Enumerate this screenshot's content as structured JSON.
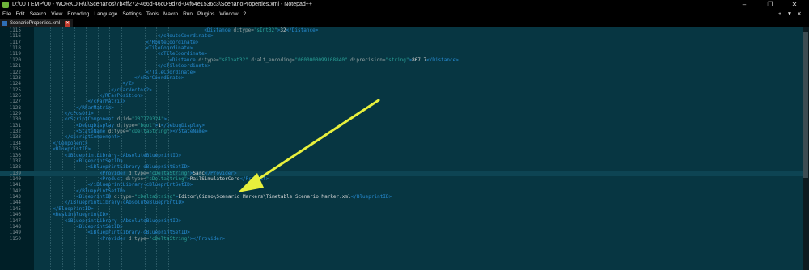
{
  "window": {
    "title": "D:\\00 TEMP\\00 - WORKDIR\\u\\Scenarios\\7b4ff272-466d-46c0-9d7d-04f64e1536c3\\ScenarioProperties.xml - Notepad++",
    "controls": [
      "–",
      "❐",
      "✕"
    ]
  },
  "menu": {
    "items": [
      "File",
      "Edit",
      "Search",
      "View",
      "Encoding",
      "Language",
      "Settings",
      "Tools",
      "Macro",
      "Run",
      "Plugins",
      "Window",
      "?"
    ],
    "right_tools": [
      "+",
      "▼",
      "✕"
    ]
  },
  "tab": {
    "label": "ScenarioProperties.xml",
    "close": "✕"
  },
  "editor": {
    "current_line": 1139,
    "lines": [
      {
        "n": "1115",
        "parts": [
          [
            "t",
            "<Distance"
          ],
          [
            "a",
            " d:type="
          ],
          [
            "s",
            "\"sInt32\""
          ],
          [
            "t",
            ">"
          ],
          [
            "x",
            "32"
          ],
          [
            "t",
            "</Distance>"
          ]
        ]
      },
      {
        "n": "1116",
        "parts": [
          [
            "t",
            "</cRouteCoordinate>"
          ]
        ]
      },
      {
        "n": "1117",
        "parts": [
          [
            "t",
            "</RouteCoordinate>"
          ]
        ]
      },
      {
        "n": "1118",
        "parts": [
          [
            "t",
            "<TileCoordinate>"
          ]
        ]
      },
      {
        "n": "1119",
        "parts": [
          [
            "t",
            "<cTileCoordinate>"
          ]
        ]
      },
      {
        "n": "1120",
        "parts": [
          [
            "t",
            "<Distance"
          ],
          [
            "a",
            " d:type="
          ],
          [
            "s",
            "\"sFloat32\""
          ],
          [
            "a",
            " d:alt_encoding="
          ],
          [
            "s",
            "\"0000000099108840\""
          ],
          [
            "a",
            " d:precision="
          ],
          [
            "s",
            "\"string\""
          ],
          [
            "t",
            ">"
          ],
          [
            "x",
            "867.7"
          ],
          [
            "t",
            "</Distance>"
          ]
        ]
      },
      {
        "n": "1121",
        "parts": [
          [
            "t",
            "</cTileCoordinate>"
          ]
        ]
      },
      {
        "n": "1122",
        "parts": [
          [
            "t",
            "</TileCoordinate>"
          ]
        ]
      },
      {
        "n": "1123",
        "parts": [
          [
            "t",
            "</cFarCoordinate>"
          ]
        ]
      },
      {
        "n": "1124",
        "parts": [
          [
            "t",
            "</Z>"
          ]
        ]
      },
      {
        "n": "1125",
        "parts": [
          [
            "t",
            "</cFarVector2>"
          ]
        ]
      },
      {
        "n": "1126",
        "parts": [
          [
            "t",
            "</RFarPosition>"
          ]
        ]
      },
      {
        "n": "1127",
        "parts": [
          [
            "t",
            "</cFarMatrix>"
          ]
        ]
      },
      {
        "n": "1128",
        "parts": [
          [
            "t",
            "</RFarMatrix>"
          ]
        ]
      },
      {
        "n": "1129",
        "parts": [
          [
            "t",
            "</cPosOri>"
          ]
        ]
      },
      {
        "n": "1130",
        "parts": [
          [
            "t",
            "<cScriptComponent"
          ],
          [
            "a",
            " d:id="
          ],
          [
            "s",
            "\"237779324\""
          ],
          [
            "t",
            ">"
          ]
        ]
      },
      {
        "n": "1131",
        "parts": [
          [
            "t",
            "<DebugDisplay"
          ],
          [
            "a",
            " d:type="
          ],
          [
            "s",
            "\"bool\""
          ],
          [
            "t",
            ">"
          ],
          [
            "x",
            "1"
          ],
          [
            "t",
            "</DebugDisplay>"
          ]
        ]
      },
      {
        "n": "1132",
        "parts": [
          [
            "t",
            "<StateName"
          ],
          [
            "a",
            " d:type="
          ],
          [
            "s",
            "\"cDeltaString\""
          ],
          [
            "t",
            "></StateName>"
          ]
        ]
      },
      {
        "n": "1133",
        "parts": [
          [
            "t",
            "</cScriptComponent>"
          ]
        ]
      },
      {
        "n": "1134",
        "parts": [
          [
            "t",
            "</Component>"
          ]
        ]
      },
      {
        "n": "1135",
        "parts": [
          [
            "t",
            "<BlueprintID>"
          ]
        ]
      },
      {
        "n": "1136",
        "parts": [
          [
            "t",
            "<iBlueprintLibrary-cAbsoluteBlueprintID>"
          ]
        ]
      },
      {
        "n": "1137",
        "parts": [
          [
            "t",
            "<BlueprintSetID>"
          ]
        ]
      },
      {
        "n": "1138",
        "parts": [
          [
            "t",
            "<iBlueprintLibrary-cBlueprintSetID>"
          ]
        ]
      },
      {
        "n": "1139",
        "parts": [
          [
            "t",
            "<Provider"
          ],
          [
            "a",
            " d:type="
          ],
          [
            "s",
            "\"cDeltaString\""
          ],
          [
            "t",
            ">"
          ],
          [
            "x",
            "Sarc"
          ],
          [
            "t",
            "</Provider>"
          ]
        ]
      },
      {
        "n": "1140",
        "parts": [
          [
            "t",
            "<Product"
          ],
          [
            "a",
            " d:type="
          ],
          [
            "s",
            "\"cDeltaString\""
          ],
          [
            "t",
            ">"
          ],
          [
            "x",
            "RailSimulatorCore"
          ],
          [
            "t",
            "</Product>"
          ]
        ]
      },
      {
        "n": "1141",
        "parts": [
          [
            "t",
            "</iBlueprintLibrary-cBlueprintSetID>"
          ]
        ]
      },
      {
        "n": "1142",
        "parts": [
          [
            "t",
            "</BlueprintSetID>"
          ]
        ]
      },
      {
        "n": "1143",
        "parts": [
          [
            "t",
            "<BlueprintID"
          ],
          [
            "a",
            " d:type="
          ],
          [
            "s",
            "\"cDeltaString\""
          ],
          [
            "t",
            ">"
          ],
          [
            "x",
            "Editor\\Gizmo\\Scenario Markers\\Timetable Scenario Marker.xml"
          ],
          [
            "t",
            "</BlueprintID>"
          ]
        ]
      },
      {
        "n": "1144",
        "parts": [
          [
            "t",
            "</iBlueprintLibrary-cAbsoluteBlueprintID>"
          ]
        ]
      },
      {
        "n": "1145",
        "parts": [
          [
            "t",
            "</BlueprintID>"
          ]
        ]
      },
      {
        "n": "1146",
        "parts": [
          [
            "t",
            "<ReskinBlueprintID>"
          ]
        ]
      },
      {
        "n": "1147",
        "parts": [
          [
            "t",
            "<iBlueprintLibrary-cAbsoluteBlueprintID>"
          ]
        ]
      },
      {
        "n": "1148",
        "parts": [
          [
            "t",
            "<BlueprintSetID>"
          ]
        ]
      },
      {
        "n": "1149",
        "parts": [
          [
            "t",
            "<iBlueprintLibrary-cBlueprintSetID>"
          ]
        ]
      },
      {
        "n": "1150",
        "parts": [
          [
            "t",
            "<Provider"
          ],
          [
            "a",
            " d:type="
          ],
          [
            "s",
            "\"cDeltaString\""
          ],
          [
            "t",
            "></Provider>"
          ]
        ]
      }
    ]
  },
  "annotation": {
    "arrow_color": "#e8f03c"
  }
}
